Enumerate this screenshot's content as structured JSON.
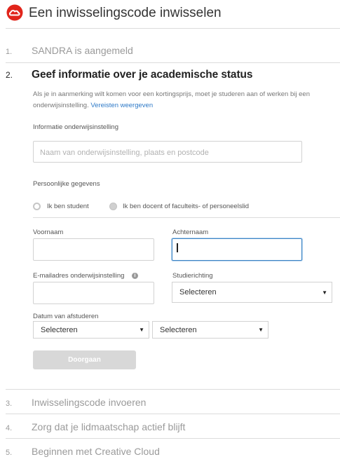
{
  "header": {
    "title": "Een inwisselingscode inwisselen",
    "logo_icon": "adobe-creative-cloud-icon",
    "brand_color": "#e1251b"
  },
  "steps": [
    {
      "num": "1.",
      "label": "SANDRA is aangemeld"
    },
    {
      "num": "2.",
      "label": "Geef informatie over je academische status"
    },
    {
      "num": "3.",
      "label": "Inwisselingscode invoeren"
    },
    {
      "num": "4.",
      "label": "Zorg dat je lidmaatschap actief blijft"
    },
    {
      "num": "5.",
      "label": "Beginnen met Creative Cloud"
    }
  ],
  "form": {
    "description": "Als je in aanmerking wilt komen voor een kortingsprijs, moet je studeren aan of werken bij een onderwijsinstelling.",
    "requirements_link": "Vereisten weergeven",
    "institution_label": "Informatie onderwijsinstelling",
    "institution_placeholder": "Naam van onderwijsinstelling, plaats en postcode",
    "personal_label": "Persoonlijke gegevens",
    "radio_student": "Ik ben student",
    "radio_staff": "Ik ben docent of faculteits- of personeelslid",
    "firstname_label": "Voornaam",
    "lastname_label": "Achternaam",
    "email_label": "E-mailadres onderwijsinstelling",
    "study_label": "Studierichting",
    "study_value": "Selecteren",
    "graduation_label": "Datum van afstuderen",
    "graduation_month": "Selecteren",
    "graduation_year": "Selecteren",
    "continue_label": "Doorgaan"
  }
}
